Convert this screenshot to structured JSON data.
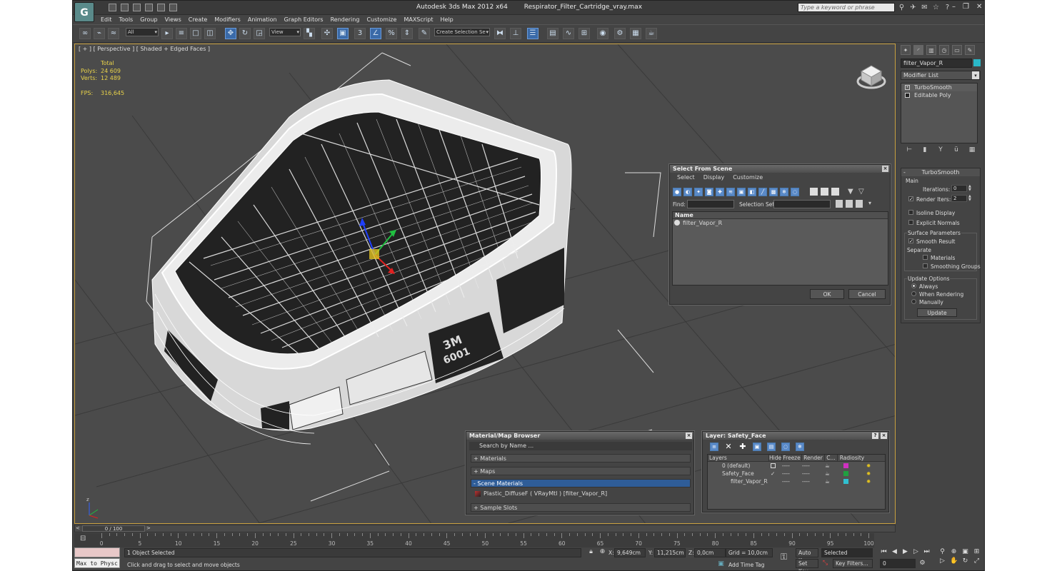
{
  "title": {
    "app": "Autodesk 3ds Max  2012 x64",
    "file": "Respirator_Filter_Cartridge_vray.max"
  },
  "search_placeholder": "Type a keyword or phrase",
  "menu": [
    "Edit",
    "Tools",
    "Group",
    "Views",
    "Create",
    "Modifiers",
    "Animation",
    "Graph Editors",
    "Rendering",
    "Customize",
    "MAXScript",
    "Help"
  ],
  "toolbar": {
    "filter_value": "All",
    "refcoord_value": "View",
    "spinner_snap": "3",
    "named_sel_value": "Create Selection Se"
  },
  "viewport": {
    "label": "[ + ] [ Perspective ] [ Shaded + Edged Faces ]",
    "stats": {
      "header": "Total",
      "polys_label": "Polys:",
      "polys": "24 609",
      "verts_label": "Verts:",
      "verts": "12 489",
      "fps_label": "FPS:",
      "fps": "316,645"
    }
  },
  "command_panel": {
    "object_name": "filter_Vapor_R",
    "object_color": "#2ab8c8",
    "modifier_list": "Modifier List",
    "stack": [
      "TurboSmooth",
      "Editable Poly"
    ],
    "turbosmooth": {
      "title": "TurboSmooth",
      "main": "Main",
      "iterations_label": "Iterations:",
      "iterations": "0",
      "render_iters_label": "Render Iters:",
      "render_iters": "2",
      "isoline": "Isoline Display",
      "explicit": "Explicit Normals",
      "surface_params": "Surface Parameters",
      "smooth_result": "Smooth Result",
      "separate": "Separate",
      "materials": "Materials",
      "smoothing_groups": "Smoothing Groups",
      "update_options": "Update Options",
      "always": "Always",
      "when_rendering": "When Rendering",
      "manually": "Manually",
      "update_btn": "Update"
    }
  },
  "select_from_scene": {
    "title": "Select From Scene",
    "menu": [
      "Select",
      "Display",
      "Customize"
    ],
    "find_label": "Find:",
    "selection_set_label": "Selection Set:",
    "column": "Name",
    "items": [
      "filter_Vapor_R"
    ],
    "ok": "OK",
    "cancel": "Cancel"
  },
  "material_browser": {
    "title": "Material/Map Browser",
    "search": "Search by Name ...",
    "sections": [
      "+ Materials",
      "+ Maps",
      "- Scene Materials"
    ],
    "scene_material": "Plastic_DiffuseF  ( VRayMtl )  [filter_Vapor_R]",
    "sample_slots": "+ Sample Slots"
  },
  "layer_dialog": {
    "title": "Layer: Safety_Face",
    "columns": [
      "Layers",
      "Hide",
      "Freeze",
      "Render",
      "C...",
      "Radiosity"
    ],
    "rows": [
      {
        "name": "0 (default)",
        "hide": "----",
        "freeze": "----",
        "color": "#d030c0"
      },
      {
        "name": "Safety_Face",
        "hide": "----",
        "freeze": "----",
        "color": "#20a040"
      },
      {
        "name": "filter_Vapor_R",
        "hide": "----",
        "freeze": "----",
        "color": "#30c0d0"
      }
    ]
  },
  "timeline": {
    "frame": "0 / 100",
    "ticks": [
      "0",
      "5",
      "10",
      "15",
      "20",
      "25",
      "30",
      "35",
      "40",
      "45",
      "50",
      "55",
      "60",
      "65",
      "70",
      "75",
      "80",
      "85",
      "90",
      "95",
      "100"
    ]
  },
  "status": {
    "maxscript": "Max to Physc",
    "selected": "1 Object Selected",
    "prompt": "Click and drag to select and move objects",
    "x_label": "X:",
    "x": "9,649cm",
    "y_label": "Y:",
    "y": "11,215cm",
    "z_label": "Z:",
    "z": "0,0cm",
    "grid": "Grid = 10,0cm",
    "add_time_tag": "Add Time Tag",
    "auto_key": "Auto Key",
    "set_key": "Set Key",
    "key_mode": "Selected",
    "key_filters": "Key Filters...",
    "frame_field": "0"
  }
}
